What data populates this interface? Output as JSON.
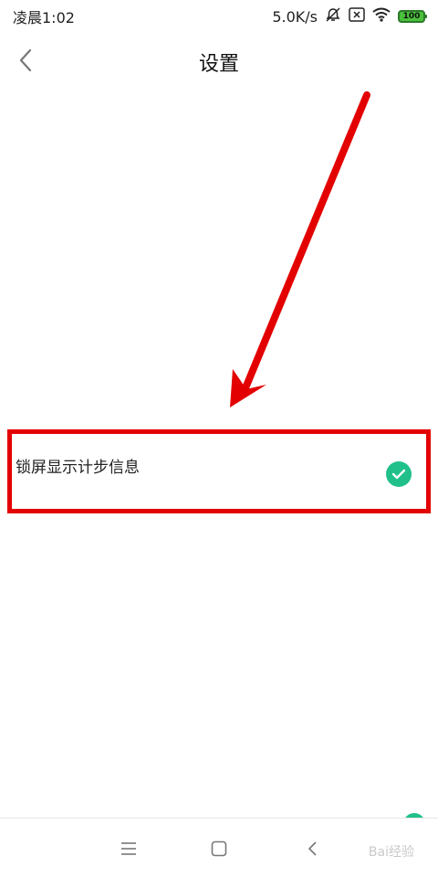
{
  "status": {
    "time": "凌晨1:02",
    "net_speed": "5.0K/s",
    "battery": "100"
  },
  "header": {
    "title": "设置"
  },
  "settings": {
    "items": [
      {
        "label": "锁屏显示计步信息",
        "checked": true
      }
    ]
  },
  "watermark": "Bai经验",
  "colors": {
    "accent": "#21c08b",
    "highlight": "#e30000",
    "battery": "#49c13b"
  }
}
